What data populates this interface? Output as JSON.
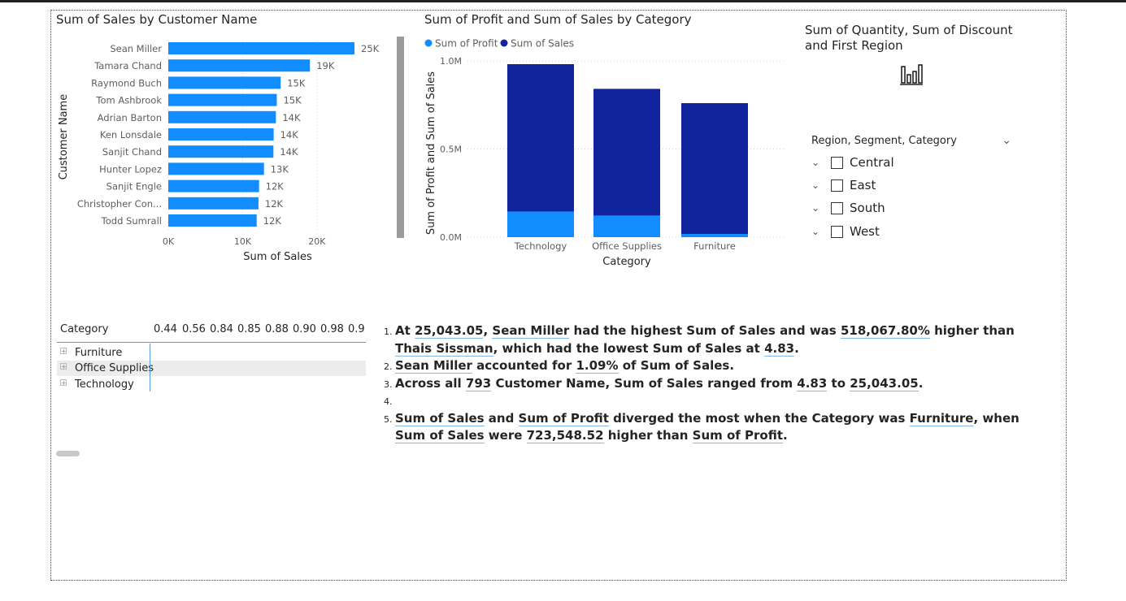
{
  "bar_chart": {
    "title": "Sum of Sales by Customer Name",
    "xlabel": "Sum of Sales",
    "ylabel": "Customer Name",
    "bar_color": "#118DFF",
    "chart_data": {
      "type": "bar",
      "orientation": "horizontal",
      "categories": [
        "Sean Miller",
        "Tamara Chand",
        "Raymond Buch",
        "Tom Ashbrook",
        "Adrian Barton",
        "Ken Lonsdale",
        "Sanjit Chand",
        "Hunter Lopez",
        "Sanjit Engle",
        "Christopher Con...",
        "Todd Sumrall"
      ],
      "values": [
        25043,
        19052,
        15117,
        14596,
        14474,
        14175,
        14142,
        12873,
        12209,
        12129,
        11892
      ],
      "data_labels": [
        "25K",
        "19K",
        "15K",
        "15K",
        "14K",
        "14K",
        "14K",
        "13K",
        "12K",
        "12K",
        "12K"
      ],
      "xlim": [
        0,
        25043
      ],
      "x_ticks": [
        0,
        10000,
        20000
      ],
      "x_tick_labels": [
        "0K",
        "10K",
        "20K"
      ],
      "grid": true
    }
  },
  "column_chart": {
    "title": "Sum of Profit and Sum of Sales by Category",
    "xlabel": "Category",
    "ylabel": "Sum of Profit and Sum of Sales",
    "legend": [
      {
        "name": "Sum of Profit",
        "color": "#118DFF"
      },
      {
        "name": "Sum of Sales",
        "color": "#12239E"
      }
    ],
    "chart_data": {
      "type": "bar",
      "stacked": true,
      "categories": [
        "Technology",
        "Office Supplies",
        "Furniture"
      ],
      "series": [
        {
          "name": "Sum of Profit",
          "values": [
            145455,
            122491,
            18451
          ]
        },
        {
          "name": "Sum of Sales",
          "values": [
            836154,
            719047,
            741999
          ]
        }
      ],
      "ylim": [
        0,
        1000000
      ],
      "y_ticks": [
        0,
        500000,
        1000000
      ],
      "y_tick_labels": [
        "0.0M",
        "0.5M",
        "1.0M"
      ],
      "grid": true,
      "legend_position": "top-left"
    }
  },
  "kpi_visual": {
    "title": "Sum of Quantity, Sum of Discount and First Region",
    "icon": "bar-chart-placeholder-icon"
  },
  "slicer": {
    "header": "Region, Segment, Category",
    "items": [
      {
        "label": "Central"
      },
      {
        "label": "East"
      },
      {
        "label": "South"
      },
      {
        "label": "West"
      }
    ]
  },
  "matrix": {
    "row_header": "Category",
    "columns": [
      "0.44",
      "0.56",
      "0.84",
      "0.85",
      "0.88",
      "0.90",
      "0.98",
      "0.9"
    ],
    "rows": [
      "Furniture",
      "Office Supplies",
      "Technology"
    ]
  },
  "narrative": {
    "items": [
      {
        "num": "1.",
        "parts": [
          {
            "t": "At "
          },
          {
            "t": "25,043.05",
            "hl": true
          },
          {
            "t": ", "
          },
          {
            "t": "Sean Miller",
            "hl": true
          },
          {
            "t": " had the highest Sum of Sales and was "
          },
          {
            "t": "518,067.80%",
            "hl": true
          },
          {
            "t": " higher than "
          },
          {
            "t": "Thais Sissman",
            "hl": true
          },
          {
            "t": ", which had the lowest Sum of Sales at "
          },
          {
            "t": "4.83",
            "hl": true
          },
          {
            "t": "."
          }
        ]
      },
      {
        "num": "2.",
        "parts": [
          {
            "t": "Sean Miller",
            "hl": true
          },
          {
            "t": " accounted for "
          },
          {
            "t": "1.09%",
            "hl": true
          },
          {
            "t": " of Sum of Sales."
          }
        ]
      },
      {
        "num": "3.",
        "parts": [
          {
            "t": "Across all "
          },
          {
            "t": "793",
            "hl": true
          },
          {
            "t": " Customer Name, Sum of Sales ranged from "
          },
          {
            "t": "4.83",
            "hl": true
          },
          {
            "t": " to "
          },
          {
            "t": "25,043.05",
            "hl": true
          },
          {
            "t": "."
          }
        ]
      },
      {
        "num": "4.",
        "parts": []
      },
      {
        "num": "5.",
        "parts": [
          {
            "t": "Sum of Sales",
            "hl": true
          },
          {
            "t": " and "
          },
          {
            "t": "Sum of Profit",
            "hl": true
          },
          {
            "t": " diverged the most when the Category was "
          },
          {
            "t": "Furniture",
            "hl": true
          },
          {
            "t": ", when "
          },
          {
            "t": "Sum of Sales",
            "hl": true
          },
          {
            "t": " were "
          },
          {
            "t": "723,548.52",
            "hl": true
          },
          {
            "t": " higher than "
          },
          {
            "t": "Sum of Profit",
            "hl": true
          },
          {
            "t": "."
          }
        ]
      }
    ]
  }
}
